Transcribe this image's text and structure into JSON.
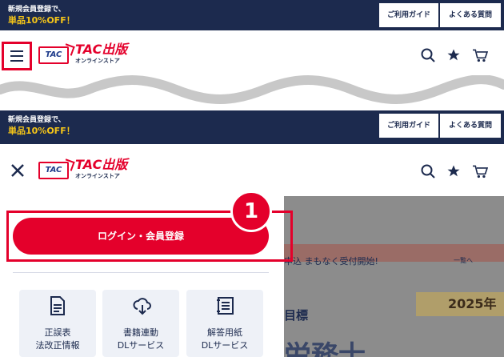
{
  "promo": {
    "line1": "新規会員登録で、",
    "line2": "単品10%OFF！"
  },
  "top_links": {
    "guide": "ご利用ガイド",
    "faq": "よくある質問"
  },
  "logo": {
    "badge": "TAC",
    "brand": "TAC出版",
    "sub": "オンラインストア"
  },
  "icons": {
    "search": "search-icon",
    "favorite": "star-icon",
    "cart": "cart-icon",
    "menu": "hamburger-icon",
    "close": "close-icon"
  },
  "menu": {
    "login_label": "ログイン・会員登録",
    "step_number": "1",
    "tiles": [
      {
        "icon": "document-icon",
        "line1": "正誤表",
        "line2": "法改正情報"
      },
      {
        "icon": "cloud-download-icon",
        "line1": "書籍連動",
        "line2": "DLサービス"
      },
      {
        "icon": "answer-sheet-icon",
        "line1": "解答用紙",
        "line2": "DLサービス"
      }
    ]
  },
  "background": {
    "news": "申込 まもなく受付開始!",
    "list_link": "一覧へ",
    "goal": "目標",
    "year": "2025年",
    "big": "労務士"
  },
  "colors": {
    "navy": "#1c2a4e",
    "red": "#e4002b",
    "yellow": "#f5c518"
  }
}
